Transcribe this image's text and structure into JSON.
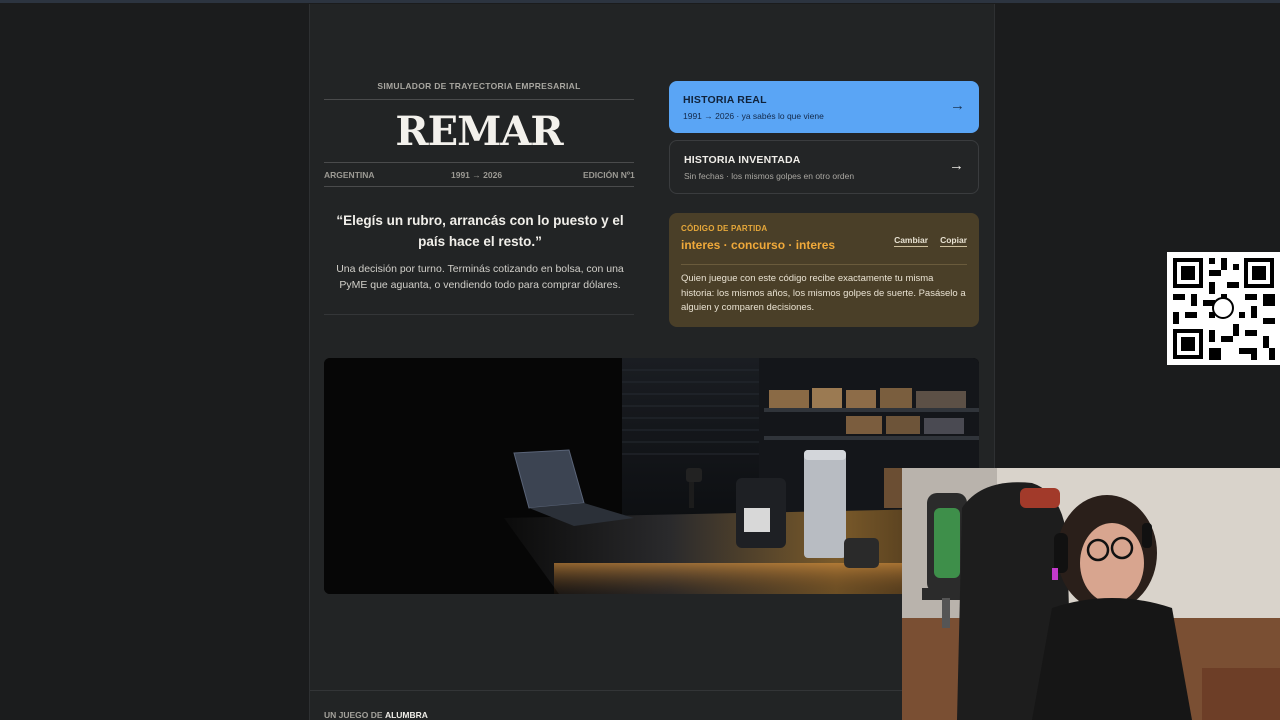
{
  "masthead": {
    "kicker": "SIMULADOR DE TRAYECTORIA EMPRESARIAL",
    "title": "REMAR",
    "meta_left": "ARGENTINA",
    "meta_center": "1991 → 2026",
    "meta_right": "EDICIÓN Nº1"
  },
  "intro": {
    "quote": "“Elegís un rubro, arrancás con lo puesto y el país hace el resto.”",
    "description": "Una decisión por turno. Terminás cotizando en bolsa, con una PyME que aguanta, o vendiendo todo para comprar dólares."
  },
  "modes": [
    {
      "title": "HISTORIA REAL",
      "subtitle": "1991 → 2026 · ya sabés lo que viene",
      "arrow": "→"
    },
    {
      "title": "HISTORIA INVENTADA",
      "subtitle": "Sin fechas · los mismos golpes en otro orden",
      "arrow": "→"
    }
  ],
  "code": {
    "label": "CÓDIGO DE PARTIDA",
    "value": "interes · concurso · interes",
    "change_label": "Cambiar",
    "copy_label": "Copiar",
    "description": "Quien juegue con este código recibe exactamente tu misma historia: los mismos años, los mismos golpes de suerte. Pasáselo a alguien y comparen decisiones."
  },
  "footer": {
    "prefix": "UN JUEGO DE",
    "brand": "ALUMBRA"
  },
  "colors": {
    "accent_blue": "#5aa5f5",
    "accent_amber": "#f0a93a",
    "page_bg": "#222425"
  },
  "icons": {
    "mode_arrow": "arrow-right-icon",
    "qr": "qr-code-icon"
  }
}
